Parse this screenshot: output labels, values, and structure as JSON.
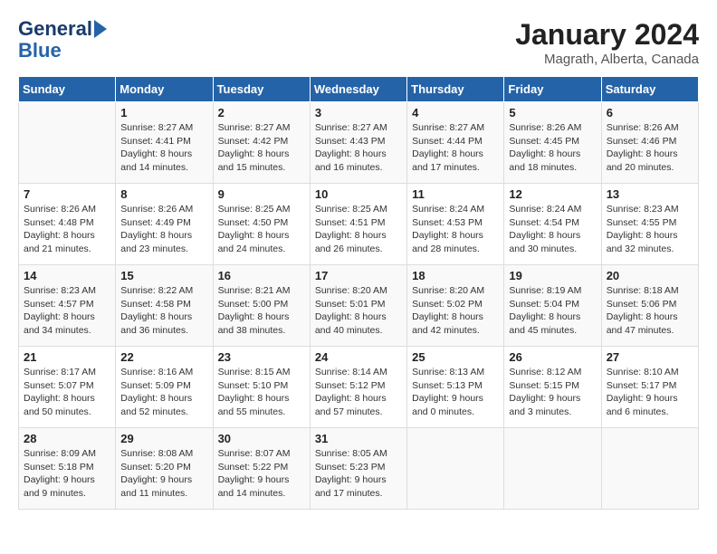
{
  "header": {
    "logo_line1": "General",
    "logo_line2": "Blue",
    "month": "January 2024",
    "location": "Magrath, Alberta, Canada"
  },
  "days_of_week": [
    "Sunday",
    "Monday",
    "Tuesday",
    "Wednesday",
    "Thursday",
    "Friday",
    "Saturday"
  ],
  "weeks": [
    [
      {
        "day": null,
        "info": null
      },
      {
        "day": "1",
        "info": "Sunrise: 8:27 AM\nSunset: 4:41 PM\nDaylight: 8 hours\nand 14 minutes."
      },
      {
        "day": "2",
        "info": "Sunrise: 8:27 AM\nSunset: 4:42 PM\nDaylight: 8 hours\nand 15 minutes."
      },
      {
        "day": "3",
        "info": "Sunrise: 8:27 AM\nSunset: 4:43 PM\nDaylight: 8 hours\nand 16 minutes."
      },
      {
        "day": "4",
        "info": "Sunrise: 8:27 AM\nSunset: 4:44 PM\nDaylight: 8 hours\nand 17 minutes."
      },
      {
        "day": "5",
        "info": "Sunrise: 8:26 AM\nSunset: 4:45 PM\nDaylight: 8 hours\nand 18 minutes."
      },
      {
        "day": "6",
        "info": "Sunrise: 8:26 AM\nSunset: 4:46 PM\nDaylight: 8 hours\nand 20 minutes."
      }
    ],
    [
      {
        "day": "7",
        "info": "Sunrise: 8:26 AM\nSunset: 4:48 PM\nDaylight: 8 hours\nand 21 minutes."
      },
      {
        "day": "8",
        "info": "Sunrise: 8:26 AM\nSunset: 4:49 PM\nDaylight: 8 hours\nand 23 minutes."
      },
      {
        "day": "9",
        "info": "Sunrise: 8:25 AM\nSunset: 4:50 PM\nDaylight: 8 hours\nand 24 minutes."
      },
      {
        "day": "10",
        "info": "Sunrise: 8:25 AM\nSunset: 4:51 PM\nDaylight: 8 hours\nand 26 minutes."
      },
      {
        "day": "11",
        "info": "Sunrise: 8:24 AM\nSunset: 4:53 PM\nDaylight: 8 hours\nand 28 minutes."
      },
      {
        "day": "12",
        "info": "Sunrise: 8:24 AM\nSunset: 4:54 PM\nDaylight: 8 hours\nand 30 minutes."
      },
      {
        "day": "13",
        "info": "Sunrise: 8:23 AM\nSunset: 4:55 PM\nDaylight: 8 hours\nand 32 minutes."
      }
    ],
    [
      {
        "day": "14",
        "info": "Sunrise: 8:23 AM\nSunset: 4:57 PM\nDaylight: 8 hours\nand 34 minutes."
      },
      {
        "day": "15",
        "info": "Sunrise: 8:22 AM\nSunset: 4:58 PM\nDaylight: 8 hours\nand 36 minutes."
      },
      {
        "day": "16",
        "info": "Sunrise: 8:21 AM\nSunset: 5:00 PM\nDaylight: 8 hours\nand 38 minutes."
      },
      {
        "day": "17",
        "info": "Sunrise: 8:20 AM\nSunset: 5:01 PM\nDaylight: 8 hours\nand 40 minutes."
      },
      {
        "day": "18",
        "info": "Sunrise: 8:20 AM\nSunset: 5:02 PM\nDaylight: 8 hours\nand 42 minutes."
      },
      {
        "day": "19",
        "info": "Sunrise: 8:19 AM\nSunset: 5:04 PM\nDaylight: 8 hours\nand 45 minutes."
      },
      {
        "day": "20",
        "info": "Sunrise: 8:18 AM\nSunset: 5:06 PM\nDaylight: 8 hours\nand 47 minutes."
      }
    ],
    [
      {
        "day": "21",
        "info": "Sunrise: 8:17 AM\nSunset: 5:07 PM\nDaylight: 8 hours\nand 50 minutes."
      },
      {
        "day": "22",
        "info": "Sunrise: 8:16 AM\nSunset: 5:09 PM\nDaylight: 8 hours\nand 52 minutes."
      },
      {
        "day": "23",
        "info": "Sunrise: 8:15 AM\nSunset: 5:10 PM\nDaylight: 8 hours\nand 55 minutes."
      },
      {
        "day": "24",
        "info": "Sunrise: 8:14 AM\nSunset: 5:12 PM\nDaylight: 8 hours\nand 57 minutes."
      },
      {
        "day": "25",
        "info": "Sunrise: 8:13 AM\nSunset: 5:13 PM\nDaylight: 9 hours\nand 0 minutes."
      },
      {
        "day": "26",
        "info": "Sunrise: 8:12 AM\nSunset: 5:15 PM\nDaylight: 9 hours\nand 3 minutes."
      },
      {
        "day": "27",
        "info": "Sunrise: 8:10 AM\nSunset: 5:17 PM\nDaylight: 9 hours\nand 6 minutes."
      }
    ],
    [
      {
        "day": "28",
        "info": "Sunrise: 8:09 AM\nSunset: 5:18 PM\nDaylight: 9 hours\nand 9 minutes."
      },
      {
        "day": "29",
        "info": "Sunrise: 8:08 AM\nSunset: 5:20 PM\nDaylight: 9 hours\nand 11 minutes."
      },
      {
        "day": "30",
        "info": "Sunrise: 8:07 AM\nSunset: 5:22 PM\nDaylight: 9 hours\nand 14 minutes."
      },
      {
        "day": "31",
        "info": "Sunrise: 8:05 AM\nSunset: 5:23 PM\nDaylight: 9 hours\nand 17 minutes."
      },
      {
        "day": null,
        "info": null
      },
      {
        "day": null,
        "info": null
      },
      {
        "day": null,
        "info": null
      }
    ]
  ]
}
